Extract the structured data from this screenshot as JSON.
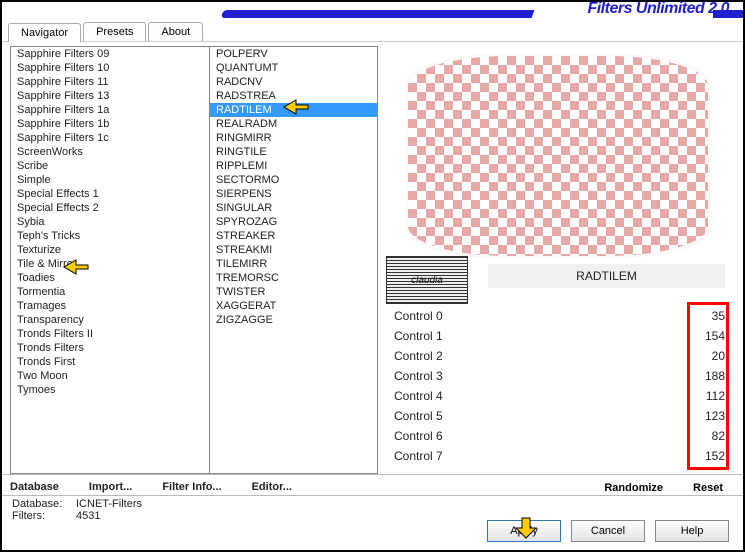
{
  "title": "Filters Unlimited 2.0",
  "tabs": [
    "Navigator",
    "Presets",
    "About"
  ],
  "active_tab": 0,
  "categories": [
    "Sapphire Filters 09",
    "Sapphire Filters 10",
    "Sapphire Filters 11",
    "Sapphire Filters 13",
    "Sapphire Filters 1a",
    "Sapphire Filters 1b",
    "Sapphire Filters 1c",
    "ScreenWorks",
    "Scribe",
    "Simple",
    "Special Effects 1",
    "Special Effects 2",
    "Sybia",
    "Teph's Tricks",
    "Texturize",
    "Tile & Mirror",
    "Toadies",
    "Tormentia",
    "Tramages",
    "Transparency",
    "Tronds Filters II",
    "Tronds Filters",
    "Tronds First",
    "Two Moon",
    "Tymoes"
  ],
  "categories_highlight": "Sybia",
  "filters": [
    "POLPERV",
    "QUANTUMT",
    "RADCNV",
    "RADSTREA",
    "RADTILEM",
    "REALRADM",
    "RINGMIRR",
    "RINGTILE",
    "RIPPLEMI",
    "SECTORMO",
    "SIERPENS",
    "SINGULAR",
    "SPYROZAG",
    "STREAKER",
    "STREAKMI",
    "TILEMIRR",
    "TREMORSC",
    "TWISTER",
    "XAGGERAT",
    "ZIGZAGGE"
  ],
  "filters_selected": "RADTILEM",
  "panel_title": "RADTILEM",
  "watermark": "claudia",
  "controls": [
    {
      "label": "Control 0",
      "value": 35
    },
    {
      "label": "Control 1",
      "value": 154
    },
    {
      "label": "Control 2",
      "value": 20
    },
    {
      "label": "Control 3",
      "value": 188
    },
    {
      "label": "Control 4",
      "value": 112
    },
    {
      "label": "Control 5",
      "value": 123
    },
    {
      "label": "Control 6",
      "value": 82
    },
    {
      "label": "Control 7",
      "value": 152
    }
  ],
  "actions": {
    "database": "Database",
    "import": "Import...",
    "filter_info": "Filter Info...",
    "editor": "Editor...",
    "randomize": "Randomize",
    "reset": "Reset"
  },
  "buttons": {
    "apply": "Apply",
    "cancel": "Cancel",
    "help": "Help"
  },
  "status": {
    "database_label": "Database:",
    "database_value": "ICNET-Filters",
    "filters_label": "Filters:",
    "filters_value": "4531"
  }
}
